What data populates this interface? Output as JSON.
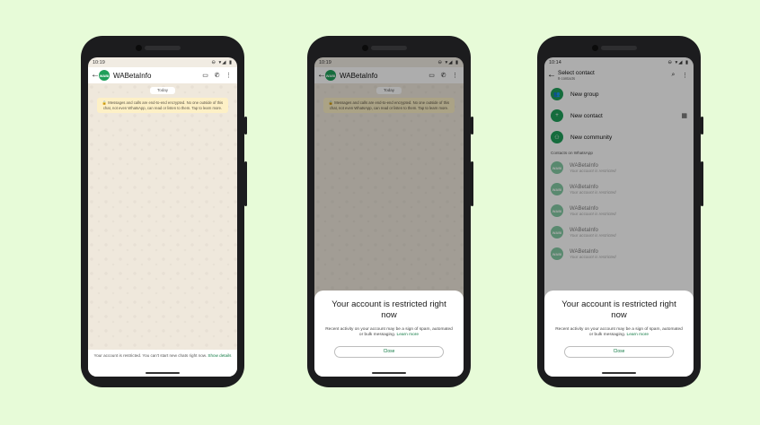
{
  "colors": {
    "background": "#e7fbd8",
    "accent": "#1f9f5a",
    "link": "#117a44"
  },
  "avatar_text": "WABI",
  "phone1": {
    "time": "10:19",
    "status_right": "⊖ ▾◢ ▮",
    "contact_name": "WABetaInfo",
    "date_chip": "Today",
    "encryption_notice": "Messages and calls are end-to-end encrypted. No one outside of this chat, not even WhatsApp, can read or listen to them. Tap to learn more.",
    "restriction_text": "Your account is restricted. You can't start new chats right now.",
    "restriction_link": "Show details"
  },
  "phone2": {
    "time": "10:19",
    "status_right": "⊖ ▾◢ ▮",
    "contact_name": "WABetaInfo",
    "date_chip": "Today",
    "encryption_notice": "Messages and calls are end-to-end encrypted. No one outside of this chat, not even WhatsApp, can read or listen to them. Tap to learn more.",
    "sheet_title": "Your account is restricted right now",
    "sheet_body": "Recent activity on your account may be a sign of spam, automated or bulk messaging.",
    "sheet_link": "Learn more",
    "close_label": "Close"
  },
  "phone3": {
    "time": "10:14",
    "status_right": "⊖ ▾◢ ▮",
    "title": "Select contact",
    "subtitle": "9 contacts",
    "actions": [
      {
        "label": "New group",
        "icon": "group-add-icon"
      },
      {
        "label": "New contact",
        "icon": "person-add-icon"
      },
      {
        "label": "New community",
        "icon": "community-icon"
      }
    ],
    "section_label": "Contacts on WhatsApp",
    "contacts": [
      {
        "name": "WABetaInfo",
        "status": "Your account is restricted"
      },
      {
        "name": "WABetaInfo",
        "status": "Your account is restricted"
      },
      {
        "name": "WABetaInfo",
        "status": "Your account is restricted"
      },
      {
        "name": "WABetaInfo",
        "status": "Your account is restricted"
      },
      {
        "name": "WABetaInfo",
        "status": "Your account is restricted"
      }
    ],
    "sheet_title": "Your account is restricted right now",
    "sheet_body": "Recent activity on your account may be a sign of spam, automated or bulk messaging.",
    "sheet_link": "Learn more",
    "close_label": "Close"
  }
}
